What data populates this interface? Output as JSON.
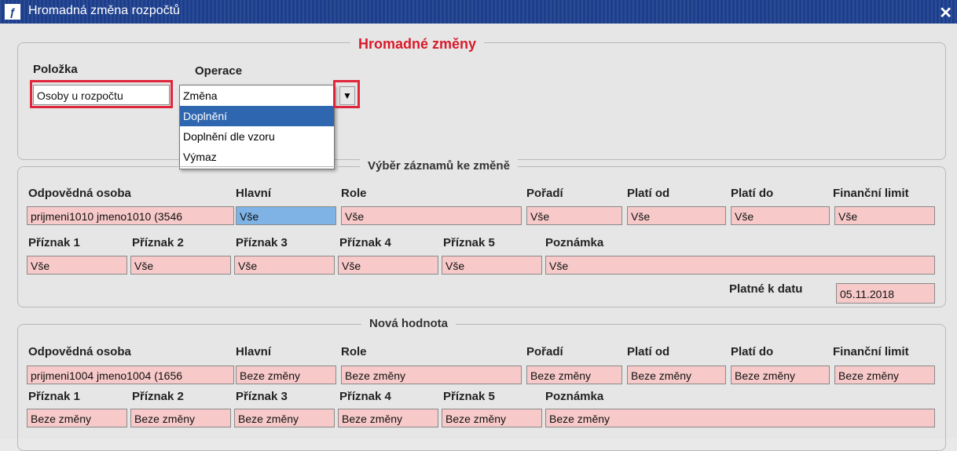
{
  "window": {
    "title": "Hromadná změna rozpočtů",
    "app_icon": "uf-logo-icon",
    "close_icon": "close-icon"
  },
  "top": {
    "section_title": "Hromadné změny",
    "polozka_label": "Položka",
    "polozka_value": "Osoby u rozpočtu",
    "operace_label": "Operace",
    "operace_options": [
      "Změna",
      "Doplnění",
      "Doplnění dle vzoru",
      "Výmaz"
    ],
    "operace_selected": "Doplnění"
  },
  "vyber": {
    "title": "Výběr záznamů ke změně",
    "headers": [
      "Odpovědná osoba",
      "Hlavní",
      "Role",
      "Pořadí",
      "Platí od",
      "Platí do",
      "Finanční limit"
    ],
    "values": [
      "prijmeni1010 jmeno1010 (3546",
      "Vše",
      "Vše",
      "Vše",
      "Vše",
      "Vše",
      "Vše"
    ],
    "headers2": [
      "Příznak 1",
      "Příznak 2",
      "Příznak 3",
      "Příznak 4",
      "Příznak 5",
      "Poznámka"
    ],
    "values2": [
      "Vše",
      "Vše",
      "Vše",
      "Vše",
      "Vše",
      "Vše"
    ],
    "platne_label": "Platné k datu",
    "platne_value": "05.11.2018"
  },
  "nova": {
    "title": "Nová hodnota",
    "headers": [
      "Odpovědná osoba",
      "Hlavní",
      "Role",
      "Pořadí",
      "Platí od",
      "Platí do",
      "Finanční limit"
    ],
    "values": [
      "prijmeni1004 jmeno1004 (1656",
      "Beze změny",
      "Beze změny",
      "Beze změny",
      "Beze změny",
      "Beze změny",
      "Beze změny"
    ],
    "headers2": [
      "Příznak 1",
      "Příznak 2",
      "Příznak 3",
      "Příznak 4",
      "Příznak 5",
      "Poznámka"
    ],
    "values2": [
      "Beze změny",
      "Beze změny",
      "Beze změny",
      "Beze změny",
      "Beze změny",
      "Beze změny"
    ]
  },
  "colors": {
    "titlebar": "#1c3e8c",
    "field_pink": "#f7c9c9",
    "highlight_red": "#e0263b",
    "selection_blue": "#2f66b0"
  }
}
